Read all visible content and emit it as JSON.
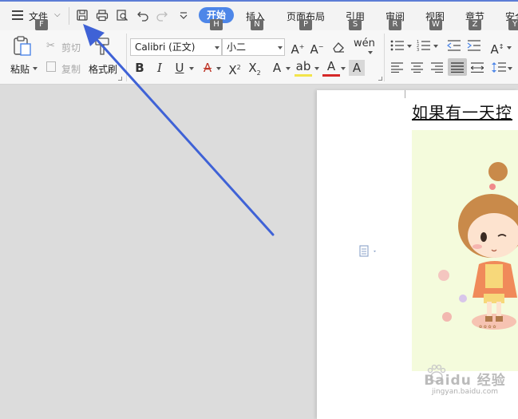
{
  "menubar": {
    "file_label": "文件",
    "tabs": [
      {
        "label": "开始",
        "key": "H",
        "active": true
      },
      {
        "label": "插入",
        "key": "N"
      },
      {
        "label": "页面布局",
        "key": "P"
      },
      {
        "label": "引用",
        "key": "S"
      },
      {
        "label": "审阅",
        "key": "R"
      },
      {
        "label": "视图",
        "key": "W"
      },
      {
        "label": "章节",
        "key": "Z"
      },
      {
        "label": "安全",
        "key": "Y"
      }
    ],
    "file_key": "F",
    "accent_color": "#4d86e8"
  },
  "ribbon": {
    "paste_label": "粘贴",
    "cut_label": "剪切",
    "copy_label": "复制",
    "format_painter_label": "格式刷",
    "font_name": "Calibri (正文)",
    "font_size": "小二"
  },
  "document": {
    "title_text": "如果有一天控"
  },
  "watermark": {
    "brand": "Baidu 经验",
    "url": "jingyan.baidu.com"
  },
  "annotation": {
    "arrow_color": "#3f62d6"
  }
}
